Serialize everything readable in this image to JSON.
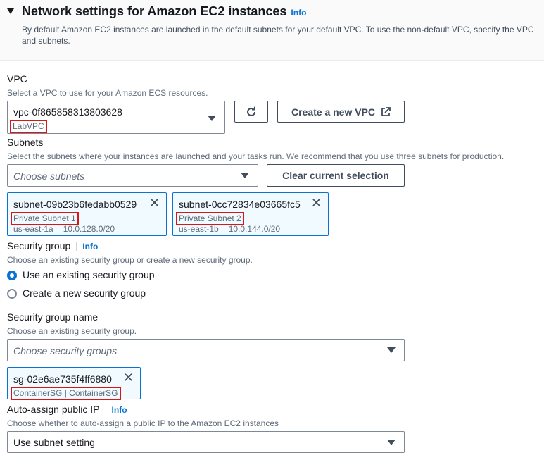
{
  "section": {
    "title": "Network settings for Amazon EC2 instances",
    "info": "Info",
    "description": "By default Amazon EC2 instances are launched in the default subnets for your default VPC. To use the non-default VPC, specify the VPC and subnets."
  },
  "vpc": {
    "label": "VPC",
    "description": "Select a VPC to use for your Amazon ECS resources.",
    "selected_id": "vpc-0f865858313803628",
    "selected_name": "LabVPC",
    "create_button": "Create a new VPC"
  },
  "subnets": {
    "label": "Subnets",
    "description": "Select the subnets where your instances are launched and your tasks run. We recommend that you use three subnets for production.",
    "placeholder": "Choose subnets",
    "clear_button": "Clear current selection",
    "tokens": [
      {
        "id": "subnet-09b23b6fedabb0529",
        "name": "Private Subnet 1",
        "az": "us-east-1a",
        "cidr": "10.0.128.0/20"
      },
      {
        "id": "subnet-0cc72834e03665fc5",
        "name": "Private Subnet 2",
        "az": "us-east-1b",
        "cidr": "10.0.144.0/20"
      }
    ]
  },
  "security_group": {
    "label": "Security group",
    "info": "Info",
    "description": "Choose an existing security group or create a new security group.",
    "options": [
      {
        "label": "Use an existing security group",
        "selected": true
      },
      {
        "label": "Create a new security group",
        "selected": false
      }
    ]
  },
  "security_group_name": {
    "label": "Security group name",
    "description": "Choose an existing security group.",
    "placeholder": "Choose security groups",
    "token": {
      "id": "sg-02e6ae735f4ff6880",
      "name": "ContainerSG | ContainerSG"
    }
  },
  "public_ip": {
    "label": "Auto-assign public IP",
    "info": "Info",
    "description": "Choose whether to auto-assign a public IP to the Amazon EC2 instances",
    "value": "Use subnet setting"
  },
  "colors": {
    "accent": "#0972d3",
    "highlight": "#d91515",
    "token_bg": "#f1faff"
  }
}
